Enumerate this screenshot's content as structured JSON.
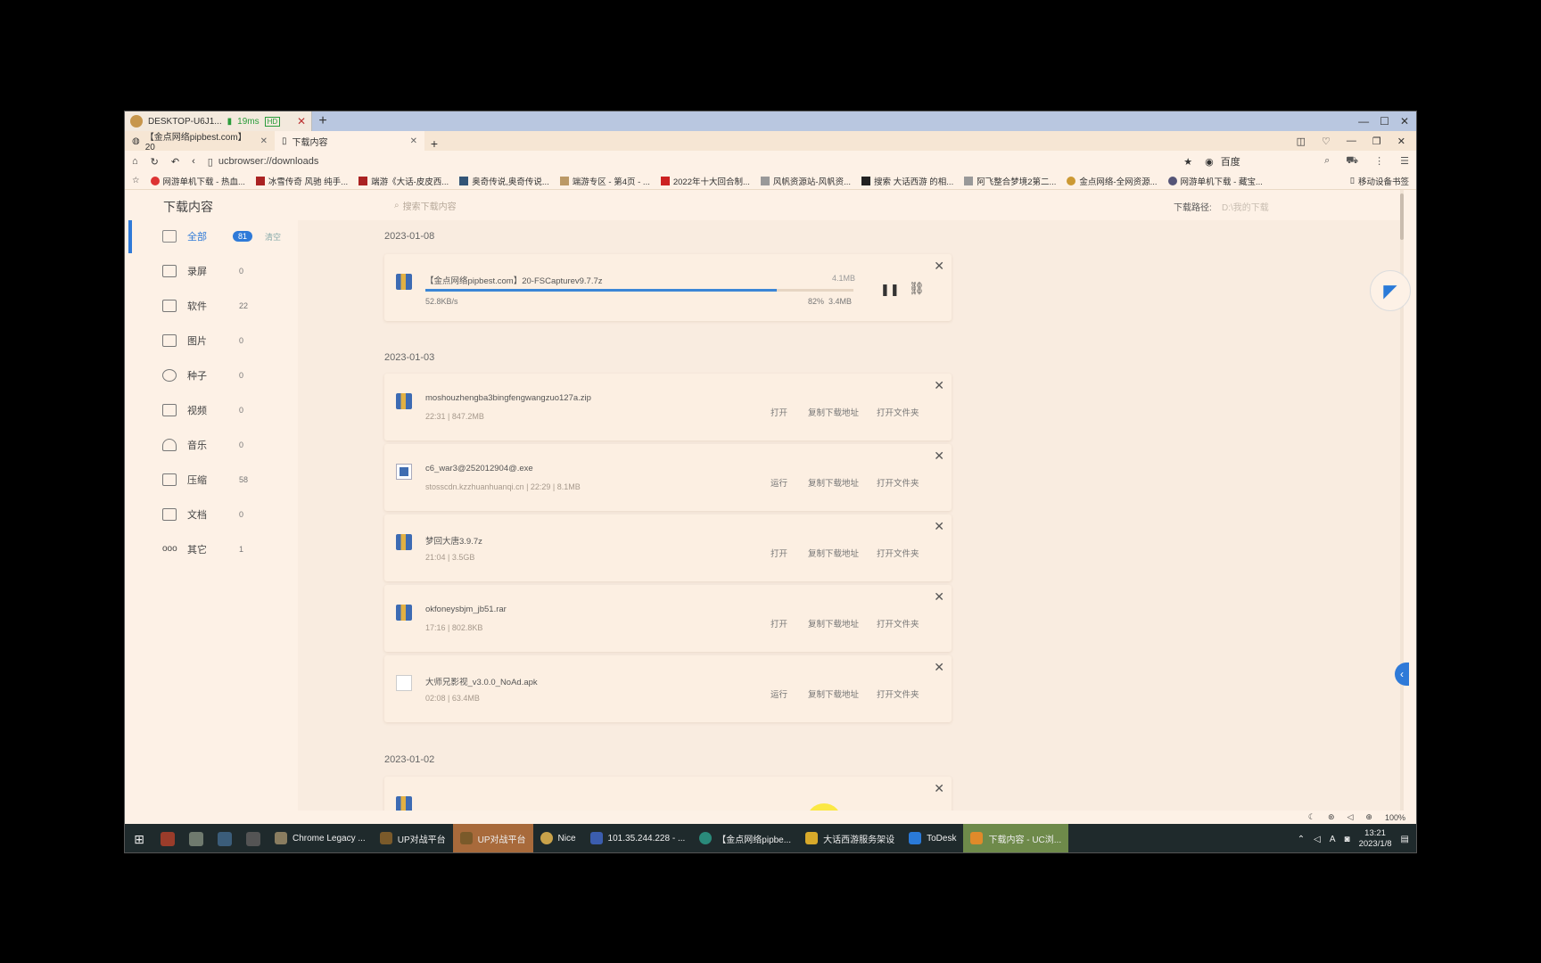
{
  "remote": {
    "tab_title": "DESKTOP-U6J1...",
    "ping": "19ms",
    "hd": "HD"
  },
  "browser": {
    "tabs": [
      {
        "label": "【金点网络pipbest.com】20"
      },
      {
        "label": "下载内容"
      }
    ],
    "url": "ucbrowser://downloads",
    "search_engine": "百度",
    "bookmarks": [
      "网游单机下载 - 热血...",
      "冰雪传奇 风驰 纯手...",
      "端游《大话-皮皮西...",
      "奥奇传说,奥奇传说...",
      "端游专区 - 第4页 - ...",
      "2022年十大回合制...",
      "风帆资源站-风帆资...",
      "搜索 大话西游 的相...",
      "阿飞整合梦境2第二...",
      "金点网络-全网资源...",
      "网游单机下载 - 藏宝..."
    ],
    "mobile_bookmarks": "移动设备书签",
    "zoom": "100%"
  },
  "downloads": {
    "title": "下载内容",
    "search_placeholder": "搜索下载内容",
    "path_label": "下载路径:",
    "path_value": "D:\\我的下载",
    "sidebar": {
      "items": [
        {
          "label": "全部",
          "count": "81",
          "clear": "清空"
        },
        {
          "label": "录屏",
          "count": "0"
        },
        {
          "label": "软件",
          "count": "22"
        },
        {
          "label": "图片",
          "count": "0"
        },
        {
          "label": "种子",
          "count": "0"
        },
        {
          "label": "视频",
          "count": "0"
        },
        {
          "label": "音乐",
          "count": "0"
        },
        {
          "label": "压缩",
          "count": "58"
        },
        {
          "label": "文档",
          "count": "0"
        },
        {
          "label": "其它",
          "count": "1"
        }
      ]
    },
    "groups": [
      {
        "date": "2023-01-08",
        "active": {
          "name": "【金点网络pipbest.com】20-FSCapturev9.7.7z",
          "total": "4.1MB",
          "speed": "52.8KB/s",
          "percent": "82%",
          "done": "3.4MB",
          "progress": 0.82
        }
      },
      {
        "date": "2023-01-03",
        "items": [
          {
            "name": "moshouzhengba3bingfengwangzuo127a.zip",
            "meta": "22:31  |  847.2MB",
            "primary": "打开",
            "copy": "复制下载地址",
            "folder": "打开文件夹"
          },
          {
            "name": "c6_war3@252012904@.exe",
            "meta": "stosscdn.kzzhuanhuanqi.cn  |  22:29  |  8.1MB",
            "primary": "运行",
            "copy": "复制下载地址",
            "folder": "打开文件夹"
          },
          {
            "name": "梦回大唐3.9.7z",
            "meta": "21:04  |  3.5GB",
            "primary": "打开",
            "copy": "复制下载地址",
            "folder": "打开文件夹"
          },
          {
            "name": "okfoneysbjm_jb51.rar",
            "meta": "17:16  |  802.8KB",
            "primary": "打开",
            "copy": "复制下载地址",
            "folder": "打开文件夹"
          },
          {
            "name": "大师兄影视_v3.0.0_NoAd.apk",
            "meta": "02:08  |  63.4MB",
            "primary": "运行",
            "copy": "复制下载地址",
            "folder": "打开文件夹"
          }
        ]
      },
      {
        "date": "2023-01-02"
      }
    ]
  },
  "taskbar": {
    "apps": [
      "Chrome Legacy ...",
      "UP对战平台",
      "UP对战平台",
      "Nice",
      "101.35.244.228 - ...",
      "【金点网络pipbe...",
      "大话西游服务架设",
      "ToDesk",
      "下载内容 - UC浏..."
    ],
    "time": "13:21",
    "date": "2023/1/8",
    "ime": "A"
  },
  "colors": {
    "accent": "#2f7ad8",
    "page_bg": "#f9ece0",
    "taskbar": "#1f2a2c"
  }
}
